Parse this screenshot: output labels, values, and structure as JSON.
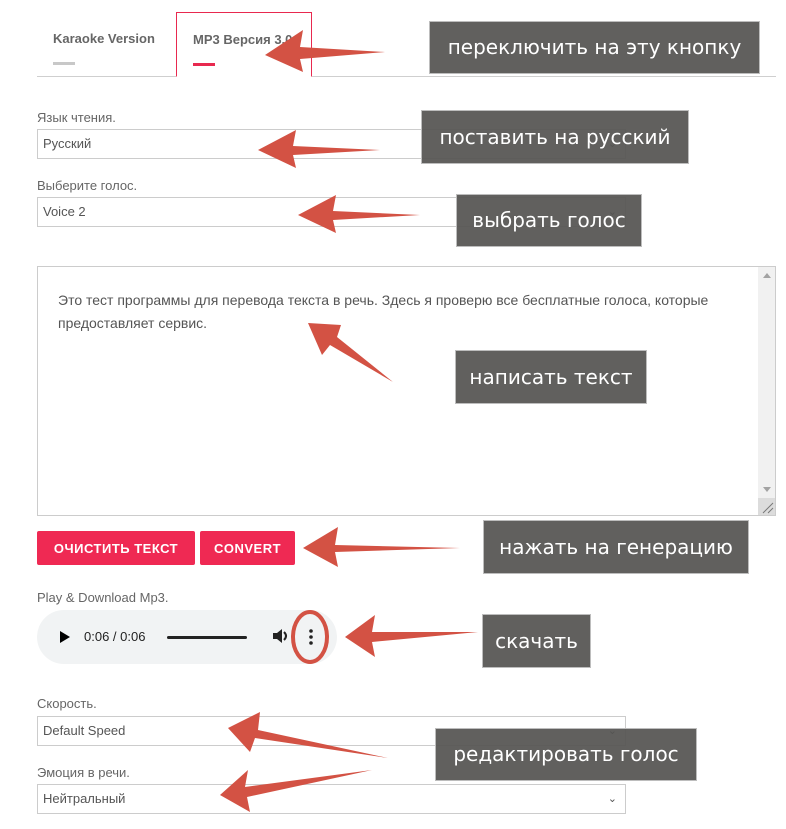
{
  "tabs": [
    {
      "label": "Karaoke Version",
      "active": false
    },
    {
      "label": "MP3 Версия 3.0",
      "active": true
    }
  ],
  "form": {
    "language": {
      "label": "Язык чтения.",
      "value": "Русский"
    },
    "voice": {
      "label": "Выберите голос.",
      "value": "Voice 2"
    },
    "text": "Это тест программы для перевода текста в речь. Здесь я проверю все бесплатные голоса, которые предоставляет сервис.",
    "buttons": {
      "clear": "ОЧИСТИТЬ ТЕКСТ",
      "convert": "CONVERT"
    },
    "player": {
      "label": "Play & Download Mp3.",
      "time": "0:06 / 0:06",
      "progress": 1.0
    },
    "speed": {
      "label": "Скорость.",
      "value": "Default Speed"
    },
    "emotion": {
      "label": "Эмоция в речи.",
      "value": "Нейтральный"
    }
  },
  "annotations": {
    "switch_tab": "переключить на эту кнопку",
    "set_russian": "поставить на русский",
    "choose_voice": "выбрать голос",
    "write_text": "написать текст",
    "press_generate": "нажать на генерацию",
    "download": "скачать",
    "edit_voice": "редактировать голос"
  },
  "colors": {
    "accent": "#ef2953",
    "annotation_bg": "#5a5957",
    "arrow": "#d35244"
  }
}
